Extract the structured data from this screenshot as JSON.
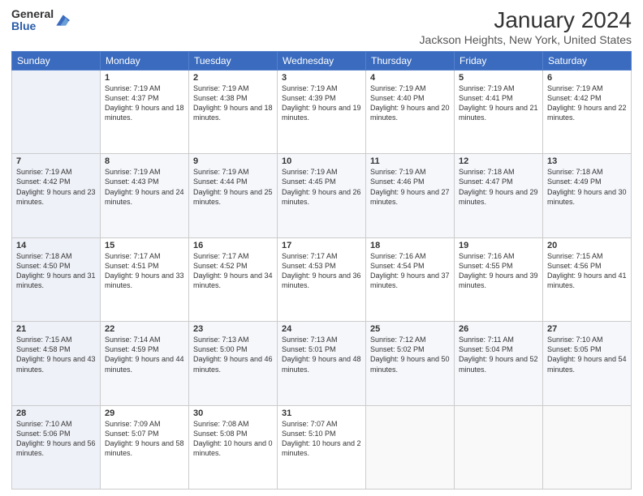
{
  "header": {
    "logo_general": "General",
    "logo_blue": "Blue",
    "title": "January 2024",
    "location": "Jackson Heights, New York, United States"
  },
  "weekdays": [
    "Sunday",
    "Monday",
    "Tuesday",
    "Wednesday",
    "Thursday",
    "Friday",
    "Saturday"
  ],
  "weeks": [
    [
      {
        "day": "",
        "sunrise": "",
        "sunset": "",
        "daylight": ""
      },
      {
        "day": "1",
        "sunrise": "Sunrise: 7:19 AM",
        "sunset": "Sunset: 4:37 PM",
        "daylight": "Daylight: 9 hours and 18 minutes."
      },
      {
        "day": "2",
        "sunrise": "Sunrise: 7:19 AM",
        "sunset": "Sunset: 4:38 PM",
        "daylight": "Daylight: 9 hours and 18 minutes."
      },
      {
        "day": "3",
        "sunrise": "Sunrise: 7:19 AM",
        "sunset": "Sunset: 4:39 PM",
        "daylight": "Daylight: 9 hours and 19 minutes."
      },
      {
        "day": "4",
        "sunrise": "Sunrise: 7:19 AM",
        "sunset": "Sunset: 4:40 PM",
        "daylight": "Daylight: 9 hours and 20 minutes."
      },
      {
        "day": "5",
        "sunrise": "Sunrise: 7:19 AM",
        "sunset": "Sunset: 4:41 PM",
        "daylight": "Daylight: 9 hours and 21 minutes."
      },
      {
        "day": "6",
        "sunrise": "Sunrise: 7:19 AM",
        "sunset": "Sunset: 4:42 PM",
        "daylight": "Daylight: 9 hours and 22 minutes."
      }
    ],
    [
      {
        "day": "7",
        "sunrise": "Sunrise: 7:19 AM",
        "sunset": "Sunset: 4:42 PM",
        "daylight": "Daylight: 9 hours and 23 minutes."
      },
      {
        "day": "8",
        "sunrise": "Sunrise: 7:19 AM",
        "sunset": "Sunset: 4:43 PM",
        "daylight": "Daylight: 9 hours and 24 minutes."
      },
      {
        "day": "9",
        "sunrise": "Sunrise: 7:19 AM",
        "sunset": "Sunset: 4:44 PM",
        "daylight": "Daylight: 9 hours and 25 minutes."
      },
      {
        "day": "10",
        "sunrise": "Sunrise: 7:19 AM",
        "sunset": "Sunset: 4:45 PM",
        "daylight": "Daylight: 9 hours and 26 minutes."
      },
      {
        "day": "11",
        "sunrise": "Sunrise: 7:19 AM",
        "sunset": "Sunset: 4:46 PM",
        "daylight": "Daylight: 9 hours and 27 minutes."
      },
      {
        "day": "12",
        "sunrise": "Sunrise: 7:18 AM",
        "sunset": "Sunset: 4:47 PM",
        "daylight": "Daylight: 9 hours and 29 minutes."
      },
      {
        "day": "13",
        "sunrise": "Sunrise: 7:18 AM",
        "sunset": "Sunset: 4:49 PM",
        "daylight": "Daylight: 9 hours and 30 minutes."
      }
    ],
    [
      {
        "day": "14",
        "sunrise": "Sunrise: 7:18 AM",
        "sunset": "Sunset: 4:50 PM",
        "daylight": "Daylight: 9 hours and 31 minutes."
      },
      {
        "day": "15",
        "sunrise": "Sunrise: 7:17 AM",
        "sunset": "Sunset: 4:51 PM",
        "daylight": "Daylight: 9 hours and 33 minutes."
      },
      {
        "day": "16",
        "sunrise": "Sunrise: 7:17 AM",
        "sunset": "Sunset: 4:52 PM",
        "daylight": "Daylight: 9 hours and 34 minutes."
      },
      {
        "day": "17",
        "sunrise": "Sunrise: 7:17 AM",
        "sunset": "Sunset: 4:53 PM",
        "daylight": "Daylight: 9 hours and 36 minutes."
      },
      {
        "day": "18",
        "sunrise": "Sunrise: 7:16 AM",
        "sunset": "Sunset: 4:54 PM",
        "daylight": "Daylight: 9 hours and 37 minutes."
      },
      {
        "day": "19",
        "sunrise": "Sunrise: 7:16 AM",
        "sunset": "Sunset: 4:55 PM",
        "daylight": "Daylight: 9 hours and 39 minutes."
      },
      {
        "day": "20",
        "sunrise": "Sunrise: 7:15 AM",
        "sunset": "Sunset: 4:56 PM",
        "daylight": "Daylight: 9 hours and 41 minutes."
      }
    ],
    [
      {
        "day": "21",
        "sunrise": "Sunrise: 7:15 AM",
        "sunset": "Sunset: 4:58 PM",
        "daylight": "Daylight: 9 hours and 43 minutes."
      },
      {
        "day": "22",
        "sunrise": "Sunrise: 7:14 AM",
        "sunset": "Sunset: 4:59 PM",
        "daylight": "Daylight: 9 hours and 44 minutes."
      },
      {
        "day": "23",
        "sunrise": "Sunrise: 7:13 AM",
        "sunset": "Sunset: 5:00 PM",
        "daylight": "Daylight: 9 hours and 46 minutes."
      },
      {
        "day": "24",
        "sunrise": "Sunrise: 7:13 AM",
        "sunset": "Sunset: 5:01 PM",
        "daylight": "Daylight: 9 hours and 48 minutes."
      },
      {
        "day": "25",
        "sunrise": "Sunrise: 7:12 AM",
        "sunset": "Sunset: 5:02 PM",
        "daylight": "Daylight: 9 hours and 50 minutes."
      },
      {
        "day": "26",
        "sunrise": "Sunrise: 7:11 AM",
        "sunset": "Sunset: 5:04 PM",
        "daylight": "Daylight: 9 hours and 52 minutes."
      },
      {
        "day": "27",
        "sunrise": "Sunrise: 7:10 AM",
        "sunset": "Sunset: 5:05 PM",
        "daylight": "Daylight: 9 hours and 54 minutes."
      }
    ],
    [
      {
        "day": "28",
        "sunrise": "Sunrise: 7:10 AM",
        "sunset": "Sunset: 5:06 PM",
        "daylight": "Daylight: 9 hours and 56 minutes."
      },
      {
        "day": "29",
        "sunrise": "Sunrise: 7:09 AM",
        "sunset": "Sunset: 5:07 PM",
        "daylight": "Daylight: 9 hours and 58 minutes."
      },
      {
        "day": "30",
        "sunrise": "Sunrise: 7:08 AM",
        "sunset": "Sunset: 5:08 PM",
        "daylight": "Daylight: 10 hours and 0 minutes."
      },
      {
        "day": "31",
        "sunrise": "Sunrise: 7:07 AM",
        "sunset": "Sunset: 5:10 PM",
        "daylight": "Daylight: 10 hours and 2 minutes."
      },
      {
        "day": "",
        "sunrise": "",
        "sunset": "",
        "daylight": ""
      },
      {
        "day": "",
        "sunrise": "",
        "sunset": "",
        "daylight": ""
      },
      {
        "day": "",
        "sunrise": "",
        "sunset": "",
        "daylight": ""
      }
    ]
  ]
}
